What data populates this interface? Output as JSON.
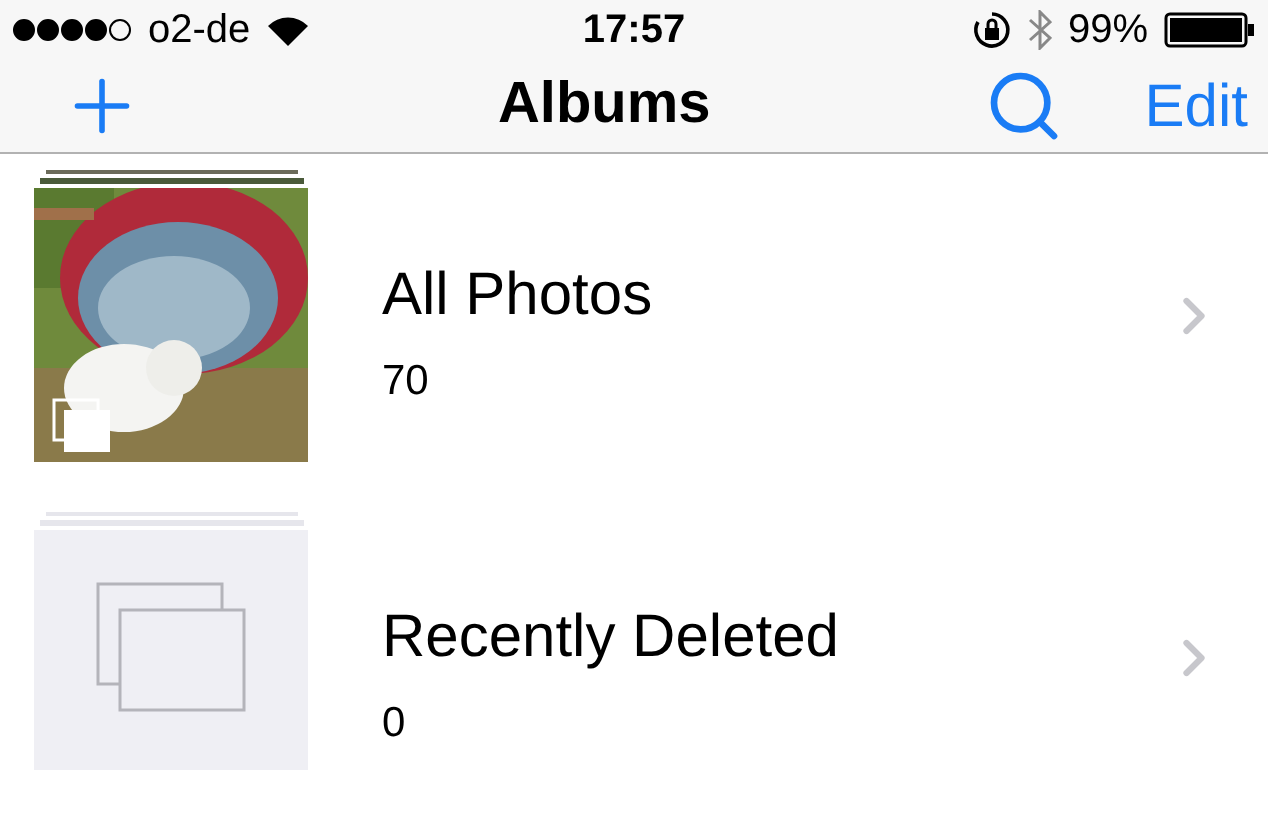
{
  "status_bar": {
    "carrier": "o2-de",
    "time": "17:57",
    "battery": "99%"
  },
  "nav": {
    "title": "Albums",
    "edit": "Edit"
  },
  "albums": [
    {
      "name": "All Photos",
      "count": "70",
      "kind": "picture"
    },
    {
      "name": "Recently Deleted",
      "count": "0",
      "kind": "placeholder"
    }
  ]
}
